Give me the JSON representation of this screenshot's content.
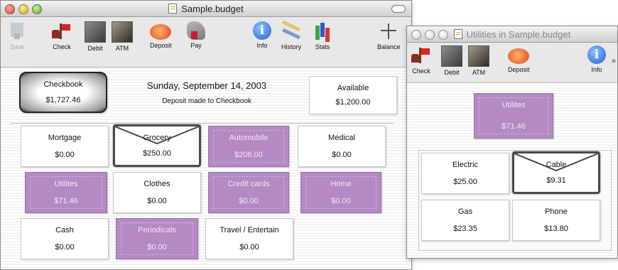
{
  "main_window": {
    "title": "Sample.budget",
    "toolbar": [
      {
        "label": "Save",
        "icon": "save-icon",
        "enabled": false
      },
      {
        "label": "Check",
        "icon": "check-icon"
      },
      {
        "label": "Debit",
        "icon": "debit-icon"
      },
      {
        "label": "ATM",
        "icon": "atm-icon"
      },
      {
        "label": "Deposit",
        "icon": "deposit-icon"
      },
      {
        "label": "Pay",
        "icon": "pay-icon"
      },
      {
        "label": "Info",
        "icon": "info-icon"
      },
      {
        "label": "History",
        "icon": "history-icon"
      },
      {
        "label": "Stats",
        "icon": "stats-icon"
      },
      {
        "label": "Balance",
        "icon": "balance-icon"
      }
    ],
    "checkbook": {
      "name": "Checkbook",
      "amount": "$1,727.46"
    },
    "date": "Sunday, September 14, 2003",
    "status": "Deposit made to Checkbook",
    "available": {
      "name": "Available",
      "amount": "$1,200.00"
    },
    "envelopes": [
      {
        "name": "Mortgage",
        "amount": "$0.00",
        "style": "white"
      },
      {
        "name": "Grocery",
        "amount": "$250.00",
        "style": "selected"
      },
      {
        "name": "Automobile",
        "amount": "$206.00",
        "style": "purple"
      },
      {
        "name": "Medical",
        "amount": "$0.00",
        "style": "white"
      },
      {
        "name": "Utilites",
        "amount": "$71.46",
        "style": "purple"
      },
      {
        "name": "Clothes",
        "amount": "$0.00",
        "style": "white"
      },
      {
        "name": "Credit cards",
        "amount": "$0.00",
        "style": "purple"
      },
      {
        "name": "Home",
        "amount": "$0.00",
        "style": "purple"
      },
      {
        "name": "Cash",
        "amount": "$0.00",
        "style": "white"
      },
      {
        "name": "Periodicals",
        "amount": "$0.00",
        "style": "purple"
      },
      {
        "name": "Travel / Entertain",
        "amount": "$0.00",
        "style": "white"
      }
    ]
  },
  "utilities_window": {
    "title": "Utilities in Sample.budget",
    "toolbar": [
      {
        "label": "Check",
        "icon": "check-icon"
      },
      {
        "label": "Debit",
        "icon": "debit-icon"
      },
      {
        "label": "ATM",
        "icon": "atm-icon"
      },
      {
        "label": "Deposit",
        "icon": "deposit-icon"
      },
      {
        "label": "Info",
        "icon": "info-icon"
      }
    ],
    "parent": {
      "name": "Utilites",
      "amount": "$71.46"
    },
    "envelopes": [
      {
        "name": "Electric",
        "amount": "$25.00",
        "style": "white"
      },
      {
        "name": "Cable",
        "amount": "$9.31",
        "style": "selected"
      },
      {
        "name": "Gas",
        "amount": "$23.35",
        "style": "white"
      },
      {
        "name": "Phone",
        "amount": "$13.80",
        "style": "white"
      }
    ]
  },
  "colors": {
    "envelope_purple": "#b38ac4",
    "selected_border": "#4a4a4a"
  }
}
